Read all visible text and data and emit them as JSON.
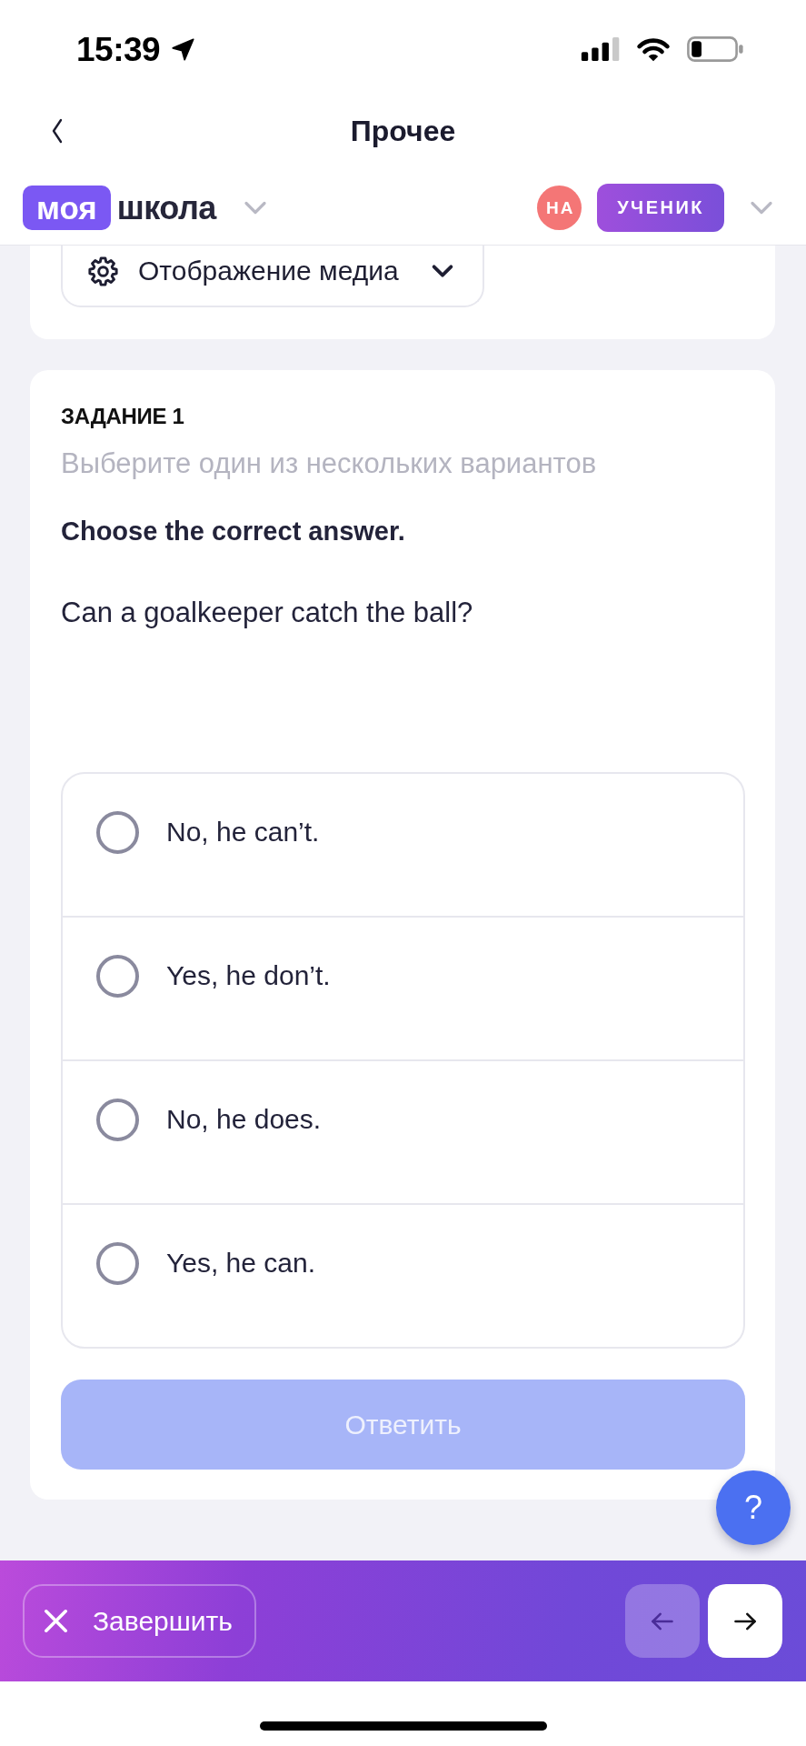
{
  "status_bar": {
    "time": "15:39"
  },
  "nav_bar": {
    "title": "Прочее"
  },
  "header": {
    "logo": {
      "badge": "моя",
      "text": "школа"
    },
    "avatar": {
      "initials": "НА"
    },
    "role": "УЧЕНИК"
  },
  "media_settings": {
    "label": "Отображение медиа"
  },
  "task": {
    "number": "ЗАДАНИЕ 1",
    "instruction": "Выберите один из нескольких вариантов",
    "prompt": "Choose the correct answer.",
    "question": "Can a goalkeeper catch the ball?",
    "options": [
      {
        "label": "No, he can’t.",
        "selected": false
      },
      {
        "label": "Yes, he don’t.",
        "selected": false
      },
      {
        "label": "No, he does.",
        "selected": false
      },
      {
        "label": "Yes, he can.",
        "selected": false
      }
    ],
    "submit": {
      "label": "Ответить",
      "disabled": true
    }
  },
  "help_button": {
    "label": "?"
  },
  "bottom_bar": {
    "finish": {
      "label": "Завершить"
    },
    "previous": {
      "disabled": true
    },
    "next": {
      "disabled": false
    }
  }
}
